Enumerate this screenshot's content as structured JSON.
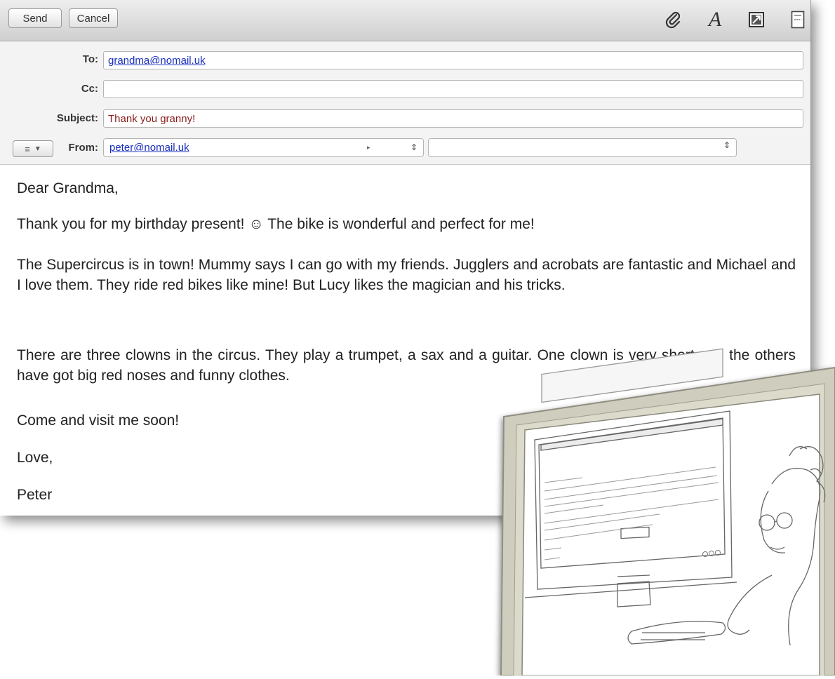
{
  "toolbar": {
    "send_label": "Send",
    "cancel_label": "Cancel",
    "icons": [
      "paperclip-icon",
      "font-icon",
      "photo-browser-icon",
      "stationery-icon"
    ]
  },
  "headers": {
    "to_label": "To:",
    "to_value": "grandma@nomail.uk",
    "cc_label": "Cc:",
    "cc_value": "",
    "subject_label": "Subject:",
    "subject_value": "Thank you granny!",
    "from_label": "From:",
    "from_value": "peter@nomail.uk"
  },
  "message": {
    "greeting": "Dear Grandma,",
    "p1": "Thank you for my birthday present! ☺ The bike is wonderful and perfect for me!",
    "p2": "The Supercircus is in town! Mummy says I can go with my friends. Jugglers and acrobats are fantastic and Michael and I love them. They ride red bikes like mine! But Lucy likes the magician and his tricks.",
    "p3": "There are three clowns in the circus. They play a trumpet, a sax and a guitar. One clown is very short and the others have got big red noses and funny clothes.",
    "closing": "Come and visit me soon!",
    "signoff": "Love,",
    "signature": "Peter"
  },
  "colors": {
    "link": "#1a2fbd",
    "subject_text": "#8b1b1b",
    "frame": "#cfcdbd"
  }
}
